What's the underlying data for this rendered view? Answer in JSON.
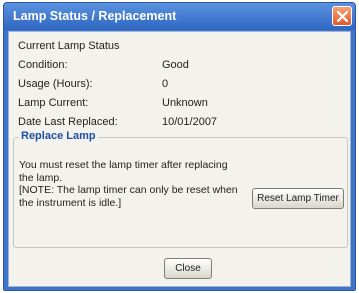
{
  "window": {
    "title": "Lamp Status / Replacement",
    "close_icon": "close-x-icon"
  },
  "status": {
    "section_label": "Current Lamp Status",
    "rows": [
      {
        "label": "Condition:",
        "value": "Good"
      },
      {
        "label": "Usage (Hours):",
        "value": "0"
      },
      {
        "label": "Lamp Current:",
        "value": "Unknown"
      },
      {
        "label": "Date Last Replaced:",
        "value": "10/01/2007"
      }
    ]
  },
  "replace": {
    "legend": "Replace Lamp",
    "message_line1": "You must reset the lamp timer after replacing the lamp.",
    "message_line2": "[NOTE: The lamp timer can only be reset when the instrument is idle.]",
    "reset_button": "Reset Lamp Timer"
  },
  "footer": {
    "close_button": "Close"
  },
  "colors": {
    "titlebar": "#3e75c8",
    "client_bg": "#f4f2ec",
    "legend_text": "#1f4fa3",
    "close_x": "#e8703e"
  }
}
